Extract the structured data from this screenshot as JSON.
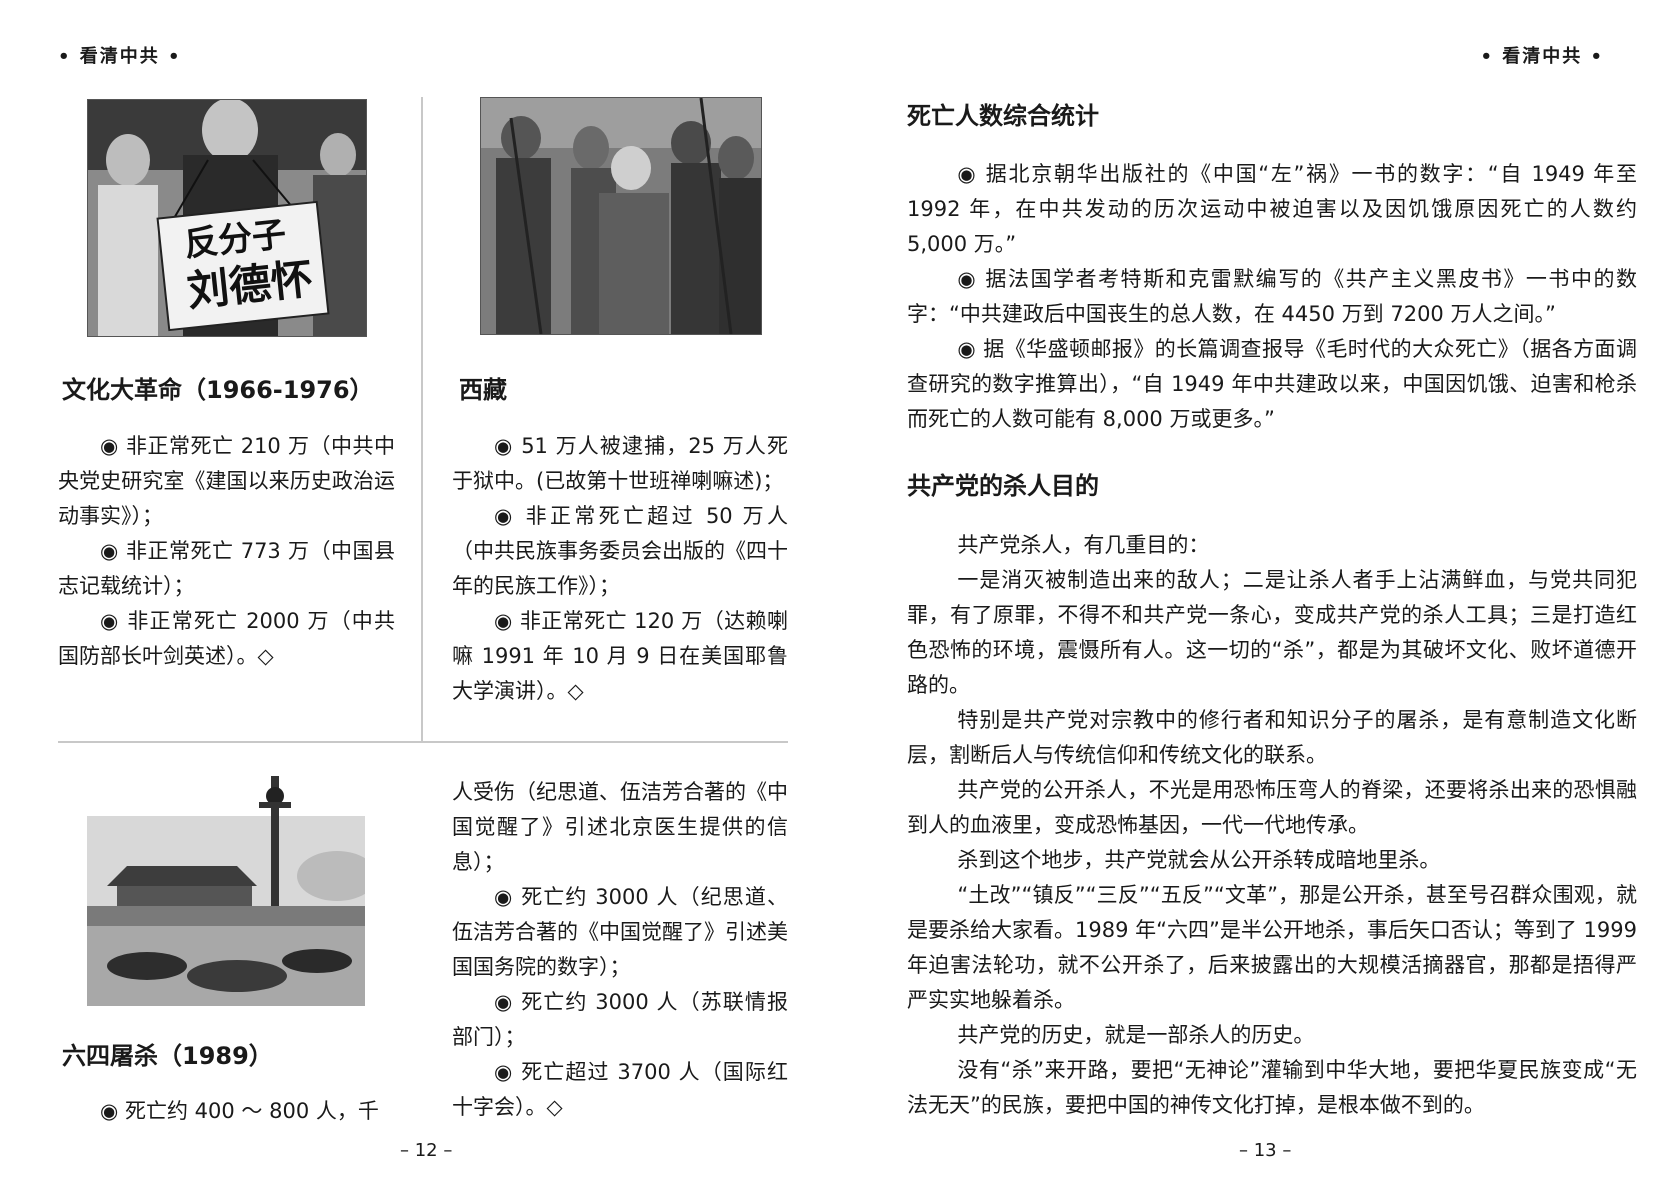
{
  "left_page": {
    "running_head": "• 看清中共 •",
    "page_number": "– 12 –",
    "sections": {
      "cultural_revolution": {
        "heading": "文化大革命（1966-1976）",
        "photo_sign_text": "反分子 刘德怀",
        "paragraphs": [
          "◉ 非正常死亡 210 万（中共中央党史研究室《建国以来历史政治运动事实》）；",
          "◉ 非正常死亡 773 万（中国县志记载统计）；",
          "◉ 非正常死亡 2000 万（中共国防部长叶剑英述）。◇"
        ]
      },
      "tibet": {
        "heading": "西藏",
        "paragraphs": [
          "◉ 51 万人被逮捕，25 万人死于狱中。(已故第十世班禅喇嘛述)；",
          "◉ 非正常死亡超过 50 万人（中共民族事务委员会出版的《四十年的民族工作》）；",
          "◉ 非正常死亡 120 万（达赖喇嘛 1991 年 10 月 9 日在美国耶鲁大学演讲）。◇"
        ]
      },
      "tiananmen": {
        "heading": "六四屠杀（1989）",
        "intro": "◉ 死亡约 400 ～ 800 人，千",
        "continued": "人受伤（纪思道、伍洁芳合著的《中国觉醒了》引述北京医生提供的信息）；",
        "paragraphs": [
          "◉ 死亡约 3000 人（纪思道、伍洁芳合著的《中国觉醒了》引述美国国务院的数字）；",
          "◉ 死亡约 3000 人（苏联情报部门）；",
          "◉ 死亡超过 3700 人（国际红十字会）。◇"
        ]
      }
    }
  },
  "right_page": {
    "running_head": "• 看清中共 •",
    "page_number": "– 13 –",
    "death_stats": {
      "heading": "死亡人数综合统计",
      "paragraphs": [
        "◉ 据北京朝华出版社的《中国“左”祸》一书的数字：“自 1949 年至 1992 年，在中共发动的历次运动中被迫害以及因饥饿原因死亡的人数约 5,000 万。”",
        "◉ 据法国学者考特斯和克雷默编写的《共产主义黑皮书》一书中的数字：“中共建政后中国丧生的总人数，在 4450 万到 7200 万人之间。”",
        "◉ 据《华盛顿邮报》的长篇调查报导《毛时代的大众死亡》（据各方面调查研究的数字推算出），“自 1949 年中共建政以来，中国因饥饿、迫害和枪杀而死亡的人数可能有 8,000 万或更多。”"
      ]
    },
    "killing_purpose": {
      "heading": "共产党的杀人目的",
      "paragraphs": [
        "共产党杀人，有几重目的：",
        "一是消灭被制造出来的敌人；二是让杀人者手上沾满鲜血，与党共同犯罪，有了原罪，不得不和共产党一条心，变成共产党的杀人工具；三是打造红色恐怖的环境，震慑所有人。这一切的“杀”，都是为其破坏文化、败坏道德开路的。",
        "特别是共产党对宗教中的修行者和知识分子的屠杀，是有意制造文化断层，割断后人与传统信仰和传统文化的联系。",
        "共产党的公开杀人，不光是用恐怖压弯人的脊梁，还要将杀出来的恐惧融到人的血液里，变成恐怖基因，一代一代地传承。",
        "杀到这个地步，共产党就会从公开杀转成暗地里杀。",
        "“土改”“镇反”“三反”“五反”“文革”，那是公开杀，甚至号召群众围观，就是要杀给大家看。1989 年“六四”是半公开地杀，事后矢口否认；等到了 1999 年迫害法轮功，就不公开杀了，后来披露出的大规模活摘器官，那都是捂得严严实实地躲着杀。",
        "共产党的历史，就是一部杀人的历史。",
        "没有“杀”来开路，要把“无神论”灌输到中华大地，要把华夏民族变成“无法无天”的民族，要把中国的神传文化打掉，是根本做不到的。"
      ]
    }
  }
}
